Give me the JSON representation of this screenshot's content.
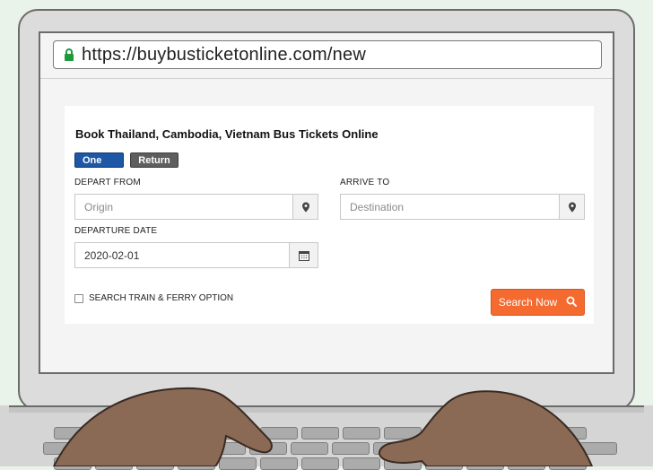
{
  "browser": {
    "url": "https://buybusticketonline.com/new",
    "lock_icon": "padlock-icon"
  },
  "form": {
    "title": "Book Thailand, Cambodia, Vietnam Bus Tickets Online",
    "tabs": {
      "one_way": "One way",
      "return": "Return"
    },
    "depart_label": "DEPART FROM",
    "depart_placeholder": "Origin",
    "arrive_label": "ARRIVE TO",
    "arrive_placeholder": "Destination",
    "date_label": "DEPARTURE DATE",
    "date_value": "2020-02-01",
    "checkbox_label": "SEARCH TRAIN & FERRY OPTION",
    "search_button": "Search Now"
  },
  "colors": {
    "one_way_active": "#1d57a6",
    "return_inactive": "#5e5e5e",
    "search_button": "#f46a2f",
    "lock": "#1f9a3b"
  }
}
